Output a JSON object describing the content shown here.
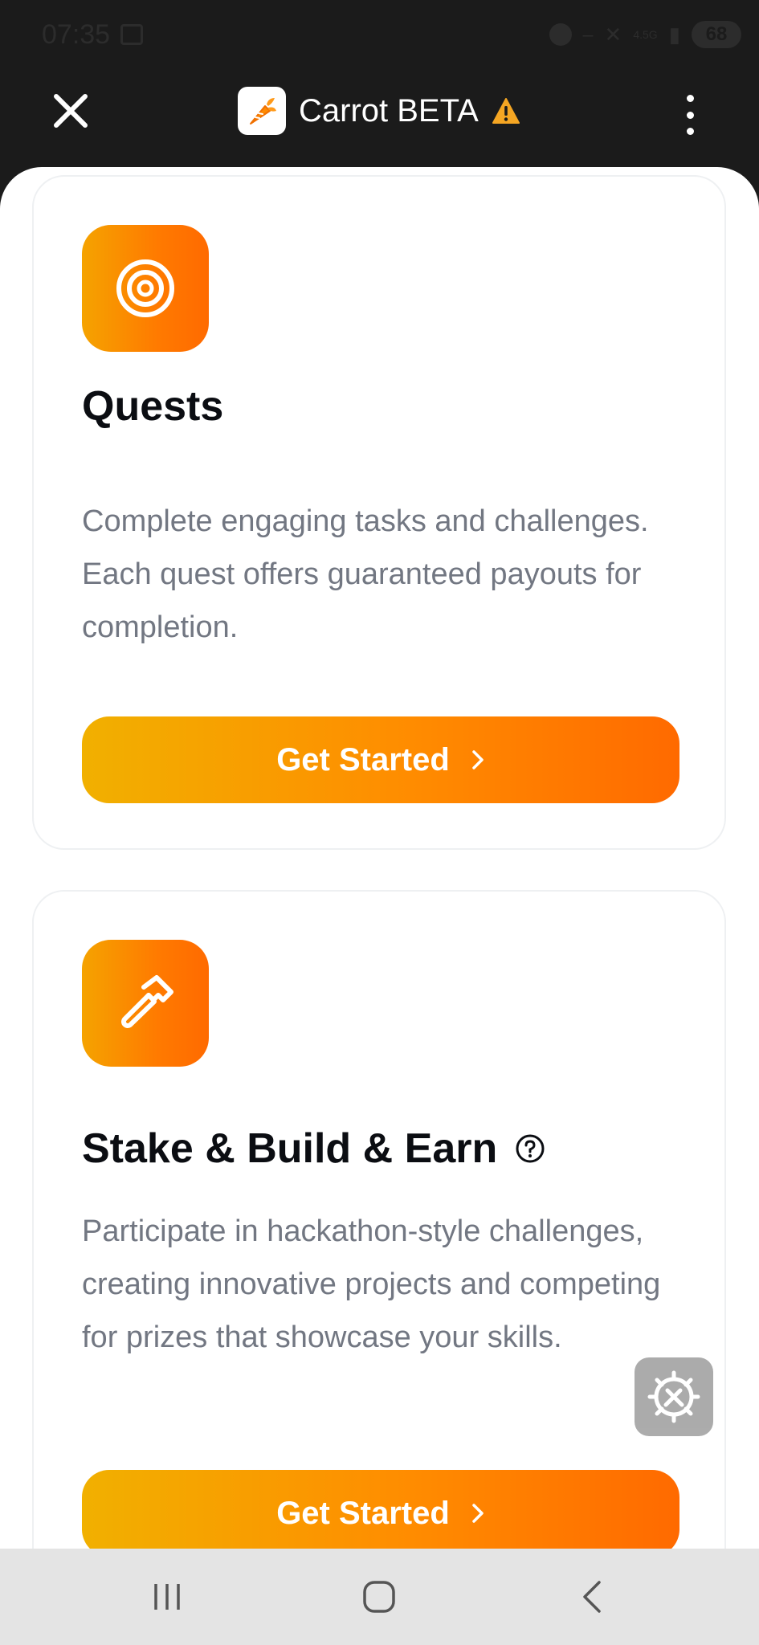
{
  "status_bar": {
    "time": "07:35",
    "network": "4.5G",
    "battery": "68"
  },
  "app_bar": {
    "title": "Carrot BETA",
    "close_icon": "close-icon",
    "more_icon": "more-vert-icon",
    "warning_icon": "warning-icon"
  },
  "cards": [
    {
      "icon": "target-icon",
      "title": "Quests",
      "description": "Complete engaging tasks and challenges. Each quest offers guaranteed payouts for completion.",
      "cta_label": "Get Started"
    },
    {
      "icon": "hammer-icon",
      "title": "Stake & Build & Earn",
      "description": "Participate in hackathon-style challenges, creating innovative projects and competing for prizes that showcase your skills.",
      "cta_label": "Get Started"
    }
  ],
  "colors": {
    "accent_start": "#f1b000",
    "accent_end": "#ff6a00",
    "title_text": "#0b0d12",
    "body_text": "#727782"
  }
}
